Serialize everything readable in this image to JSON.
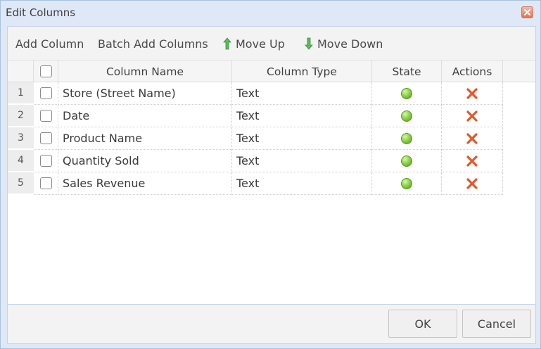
{
  "window": {
    "title": "Edit Columns"
  },
  "toolbar": {
    "add_column": "Add Column",
    "batch_add_columns": "Batch Add Columns",
    "move_up": "Move Up",
    "move_down": "Move Down"
  },
  "grid": {
    "headers": {
      "column_name": "Column Name",
      "column_type": "Column Type",
      "state": "State",
      "actions": "Actions"
    },
    "rows": [
      {
        "num": "1",
        "name": "Store (Street Name)",
        "type": "Text",
        "state": "valid",
        "checked": false
      },
      {
        "num": "2",
        "name": "Date",
        "type": "Text",
        "state": "valid",
        "checked": false
      },
      {
        "num": "3",
        "name": "Product Name",
        "type": "Text",
        "state": "valid",
        "checked": false
      },
      {
        "num": "4",
        "name": "Quantity Sold",
        "type": "Text",
        "state": "valid",
        "checked": false
      },
      {
        "num": "5",
        "name": "Sales Revenue",
        "type": "Text",
        "state": "valid",
        "checked": false
      }
    ]
  },
  "footer": {
    "ok": "OK",
    "cancel": "Cancel"
  },
  "icons": {
    "close": "close-icon",
    "move_up": "arrow-up-icon",
    "move_down": "arrow-down-icon",
    "state": "green-status-dot-icon",
    "delete": "red-x-delete-icon"
  },
  "colors": {
    "window_bg": "#dfe8f6",
    "arrow_green": "#5cb85c",
    "delete_red": "#e0572a",
    "state_green": "#8fd24a"
  }
}
